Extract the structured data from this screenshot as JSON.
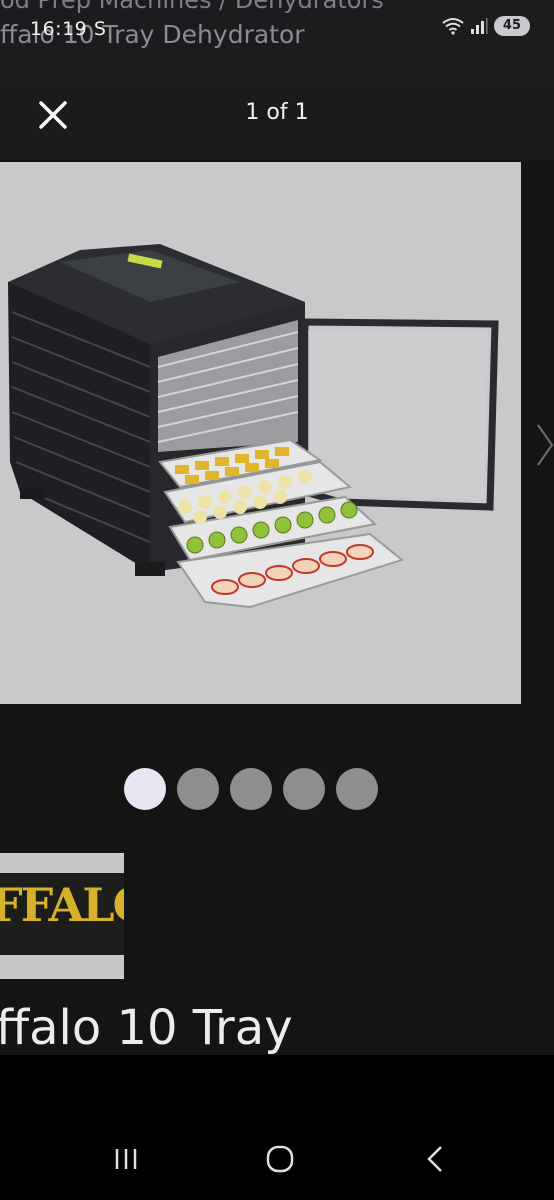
{
  "status_bar": {
    "time": "16:19",
    "status_letter": "S",
    "battery": "45",
    "background_breadcrumb": "od Prep Machines  /  Dehydrators",
    "background_title": "ffalo 10 Tray Dehydrator"
  },
  "viewer": {
    "counter": "1 of 1",
    "close_icon": "close-icon",
    "next_icon": "chevron-right-icon",
    "image_alt": "Buffalo 10 Tray Dehydrator with open door and trays of dried fruit",
    "dots": [
      {
        "active": true
      },
      {
        "active": false
      },
      {
        "active": false
      },
      {
        "active": false
      },
      {
        "active": false
      }
    ]
  },
  "product": {
    "brand_logo_text": "FFALO",
    "title": "ffalo 10 Tray"
  },
  "nav_bar": {
    "recents_icon": "recents-icon",
    "home_icon": "home-icon",
    "back_icon": "back-icon"
  },
  "colors": {
    "background": "#141414",
    "image_backdrop": "#c9c9cb",
    "dot_active": "#e6e7f3",
    "dot_inactive": "#8e8e90",
    "brand_gold": "#d6b12a"
  }
}
